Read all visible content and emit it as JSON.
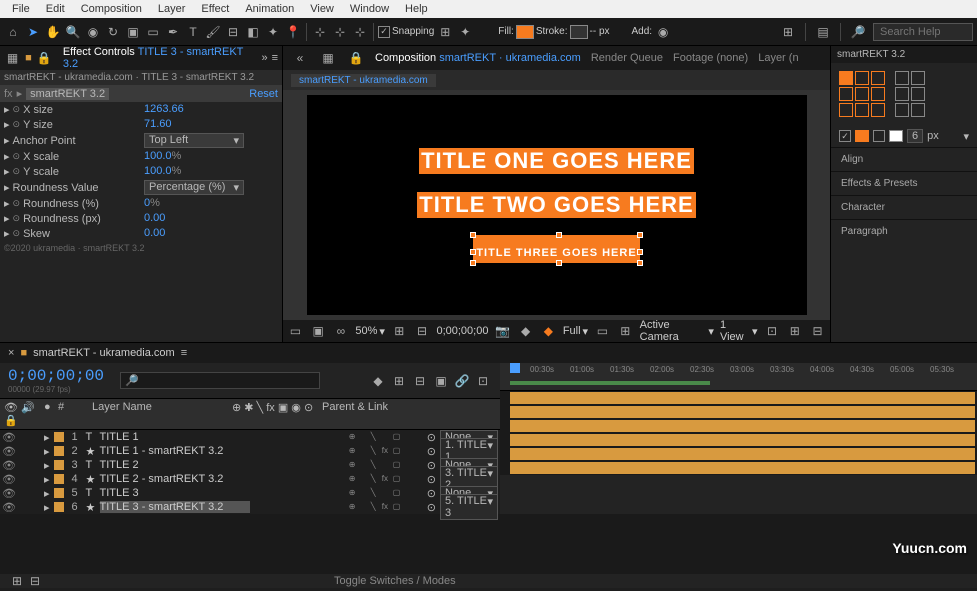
{
  "menu": [
    "File",
    "Edit",
    "Composition",
    "Layer",
    "Effect",
    "Animation",
    "View",
    "Window",
    "Help"
  ],
  "toolbar": {
    "snapping": "Snapping",
    "fill_label": "Fill:",
    "stroke_label": "Stroke:",
    "stroke_px": "-- px",
    "add_label": "Add:",
    "search_placeholder": "Search Help"
  },
  "effect_panel": {
    "tab_prefix": "Effect Controls",
    "tab_layer": "TITLE 3 - smartREKT 3.2",
    "breadcrumb": "smartREKT - ukramedia.com · TITLE 3 - smartREKT 3.2",
    "effect_name": "smartREKT 3.2",
    "reset": "Reset",
    "props": [
      {
        "label": "X size",
        "value": "1263.66",
        "stopwatch": true
      },
      {
        "label": "Y size",
        "value": "71.60",
        "stopwatch": true
      },
      {
        "label": "Anchor Point",
        "value": "Top Left",
        "dropdown": true
      },
      {
        "label": "X scale",
        "value": "100.0",
        "pct": true,
        "stopwatch": true
      },
      {
        "label": "Y scale",
        "value": "100.0",
        "pct": true,
        "stopwatch": true
      },
      {
        "label": "Roundness Value",
        "value": "Percentage (%)",
        "dropdown": true
      },
      {
        "label": "Roundness (%)",
        "value": "0",
        "pct": true,
        "stopwatch": true
      },
      {
        "label": "Roundness (px)",
        "value": "0.00",
        "stopwatch": true
      },
      {
        "label": "Skew",
        "value": "0.00",
        "stopwatch": true
      }
    ],
    "copyright": "©2020 ukramedia · smartREKT 3.2"
  },
  "comp_panel": {
    "tabs": [
      {
        "prefix": "Composition",
        "name": "smartREKT · ukramedia.com",
        "active": true
      },
      {
        "name": "Render Queue"
      },
      {
        "name": "Footage (none)"
      },
      {
        "name": "Layer (n"
      }
    ],
    "subtab": "smartREKT - ukramedia.com",
    "titles": [
      "TITLE ONE GOES HERE",
      "TITLE TWO GOES HERE",
      "TITLE THREE GOES HERE"
    ],
    "controls": {
      "zoom": "50%",
      "timecode": "0;00;00;00",
      "resolution": "Full",
      "camera": "Active Camera",
      "views": "1 View"
    }
  },
  "right_panel": {
    "tab": "smartREKT 3.2",
    "px_value": "6",
    "px_label": "px",
    "sections": [
      "Align",
      "Effects & Presets",
      "Character",
      "Paragraph"
    ]
  },
  "timeline": {
    "tab": "smartREKT - ukramedia.com",
    "timecode": "0;00;00;00",
    "fps_info": "00000 (29.97 fps)",
    "col_headers": {
      "num": "#",
      "name": "Layer Name",
      "parent": "Parent & Link"
    },
    "ruler": [
      "00:30s",
      "01:00s",
      "01:30s",
      "02:00s",
      "02:30s",
      "03:00s",
      "03:30s",
      "04:00s",
      "04:30s",
      "05:00s",
      "05:30s"
    ],
    "layers": [
      {
        "num": "1",
        "icon": "T",
        "name": "TITLE 1",
        "parent": "None"
      },
      {
        "num": "2",
        "icon": "★",
        "name": "TITLE 1 - smartREKT 3.2",
        "parent": "1. TITLE 1"
      },
      {
        "num": "3",
        "icon": "T",
        "name": "TITLE 2",
        "parent": "None"
      },
      {
        "num": "4",
        "icon": "★",
        "name": "TITLE 2 - smartREKT 3.2",
        "parent": "3. TITLE 2"
      },
      {
        "num": "5",
        "icon": "T",
        "name": "TITLE 3",
        "parent": "None"
      },
      {
        "num": "6",
        "icon": "★",
        "name": "TITLE 3 - smartREKT 3.2",
        "parent": "5. TITLE 3",
        "selected": true
      }
    ],
    "toggle": "Toggle Switches / Modes"
  },
  "watermark": "Yuucn.com"
}
